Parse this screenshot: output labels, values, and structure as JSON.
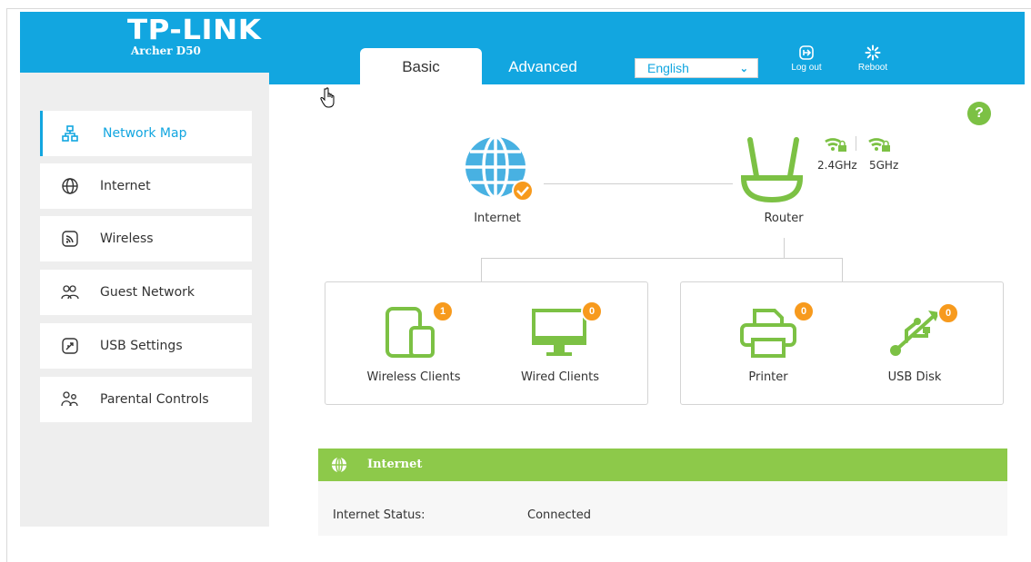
{
  "header": {
    "brand": "TP-LINK",
    "model": "Archer D50",
    "tabs": [
      {
        "label": "Basic",
        "active": true
      },
      {
        "label": "Advanced",
        "active": false
      }
    ],
    "language": {
      "selected": "English"
    },
    "logout_label": "Log out",
    "reboot_label": "Reboot",
    "accent_color": "#12a6e0"
  },
  "sidebar": {
    "items": [
      {
        "label": "Network Map",
        "icon": "network-map-icon",
        "active": true
      },
      {
        "label": "Internet",
        "icon": "globe-icon",
        "active": false
      },
      {
        "label": "Wireless",
        "icon": "wireless-icon",
        "active": false
      },
      {
        "label": "Guest Network",
        "icon": "guest-network-icon",
        "active": false
      },
      {
        "label": "USB Settings",
        "icon": "usb-settings-icon",
        "active": false
      },
      {
        "label": "Parental Controls",
        "icon": "parental-controls-icon",
        "active": false
      }
    ]
  },
  "network_map": {
    "help": "?",
    "internet_label": "Internet",
    "router_label": "Router",
    "band_24": "2.4GHz",
    "band_5": "5GHz",
    "clients": [
      {
        "label": "Wireless Clients",
        "count": "1",
        "icon": "tablet-phone-icon"
      },
      {
        "label": "Wired Clients",
        "count": "0",
        "icon": "monitor-icon"
      },
      {
        "label": "Printer",
        "count": "0",
        "icon": "printer-icon"
      },
      {
        "label": "USB Disk",
        "count": "0",
        "icon": "usb-icon"
      }
    ],
    "green_color": "#7cc144",
    "badge_color": "#f79a1d"
  },
  "internet_panel": {
    "title": "Internet",
    "status_label": "Internet Status:",
    "status_value": "Connected"
  }
}
